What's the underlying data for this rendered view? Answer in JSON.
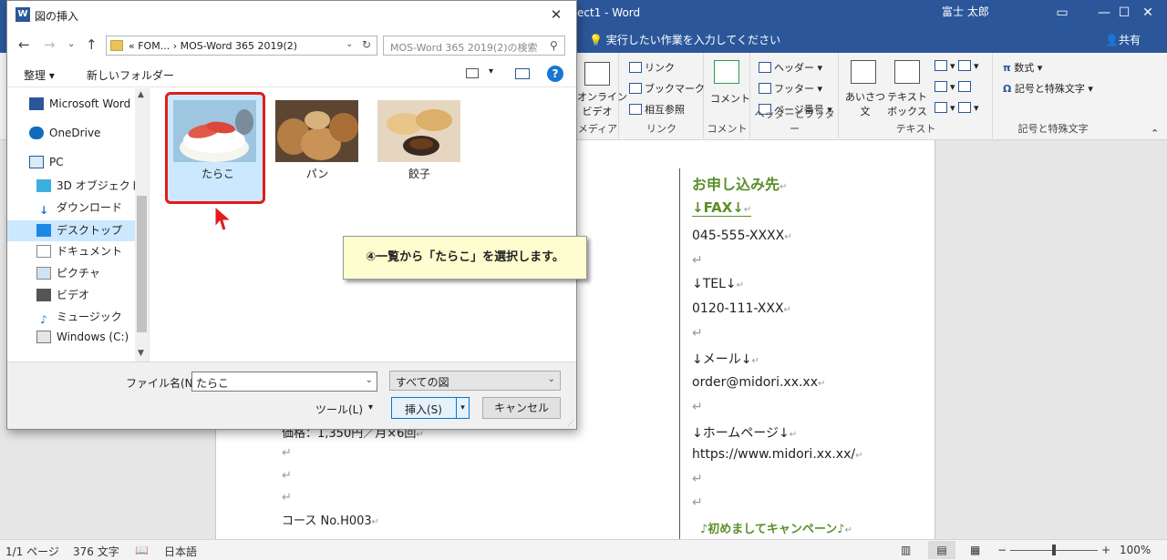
{
  "word": {
    "title": "ect1 - Word",
    "user": "富士 太郎",
    "tell_me": "実行したい作業を入力してください",
    "share": "共有",
    "ribbon": {
      "media": {
        "label": "メディア",
        "online_video": "オンライン\nビデオ"
      },
      "links": {
        "label": "リンク",
        "link": "リンク",
        "bookmark": "ブックマーク",
        "crossref": "相互参照"
      },
      "comments": {
        "label": "コメント",
        "comment": "コメント"
      },
      "header_footer": {
        "label": "ヘッダーとフッター",
        "header": "ヘッダー",
        "footer": "フッター",
        "page_number": "ページ番号"
      },
      "text": {
        "label": "テキスト",
        "greeting": "あいさつ\n文",
        "textbox": "テキスト\nボックス"
      },
      "symbols": {
        "label": "記号と特殊文字",
        "equation": "数式",
        "symbol": "記号と特殊文字"
      }
    },
    "document": {
      "right": [
        "お申し込み先",
        "↓FAX↓",
        "045-555-XXXX",
        "",
        "↓TEL↓",
        "0120-111-XXX",
        "",
        "↓メール↓",
        "order@midori.xx.xx",
        "",
        "↓ホームページ↓",
        "https://www.midori.xx.xx/",
        "",
        "",
        "♪初めましてキャンペーン♪"
      ],
      "left": [
        "価格：1,350円／月×6回",
        "",
        "",
        "",
        "コース No.H003"
      ]
    },
    "status": {
      "page": "1/1 ページ",
      "words": "376 文字",
      "language": "日本語",
      "zoom": "100%",
      "zoom_level": 0.5
    }
  },
  "dialog": {
    "title": "図の挿入",
    "breadcrumb": "«  FOM...  ›  MOS-Word 365 2019(2)",
    "search_placeholder": "MOS-Word 365 2019(2)の検索",
    "organize": "整理 ▾",
    "new_folder": "新しいフォルダー",
    "nav": [
      {
        "label": "Microsoft Word"
      },
      {
        "label": "OneDrive"
      },
      {
        "label": "PC"
      },
      {
        "label": "3D オブジェクト"
      },
      {
        "label": "ダウンロード"
      },
      {
        "label": "デスクトップ"
      },
      {
        "label": "ドキュメント"
      },
      {
        "label": "ピクチャ"
      },
      {
        "label": "ビデオ"
      },
      {
        "label": "ミュージック"
      },
      {
        "label": "Windows (C:)"
      }
    ],
    "files": [
      {
        "name": "たらこ"
      },
      {
        "name": "パン"
      },
      {
        "name": "餃子"
      }
    ],
    "callout": "④一覧から「たらこ」を選択します。",
    "filename_label": "ファイル名(N):",
    "filename_value": "たらこ",
    "filetype": "すべての図",
    "tools": "ツール(L)",
    "insert": "挿入(S)",
    "cancel": "キャンセル",
    "colors": {
      "accent": "#2b579a",
      "highlight": "#e31b1b",
      "selection": "#cce8ff",
      "green_text": "#5b8f2a"
    }
  }
}
